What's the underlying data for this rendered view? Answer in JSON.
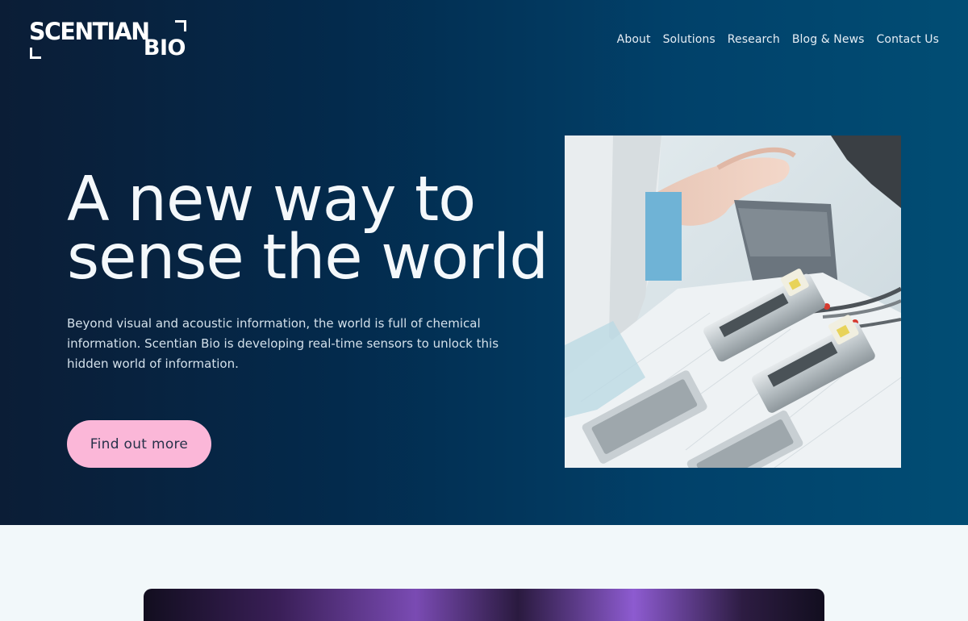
{
  "brand": {
    "line1": "SCENTIAN",
    "line2": "BIO"
  },
  "nav": {
    "items": [
      {
        "label": "About"
      },
      {
        "label": "Solutions"
      },
      {
        "label": "Research"
      },
      {
        "label": "Blog & News"
      },
      {
        "label": "Contact Us"
      }
    ]
  },
  "hero": {
    "headline_line1": "A new way to",
    "headline_line2": "sense the world",
    "description": "Beyond visual and acoustic information, the world is full of chemical information. Scentian Bio is developing real-time sensors to unlock this hidden world of information.",
    "cta_label": "Find out more"
  },
  "colors": {
    "hero_gradient_start": "#0b1d36",
    "hero_gradient_end": "#014d74",
    "cta_background": "#fbb7d8",
    "page_background": "#f2f8fa"
  }
}
